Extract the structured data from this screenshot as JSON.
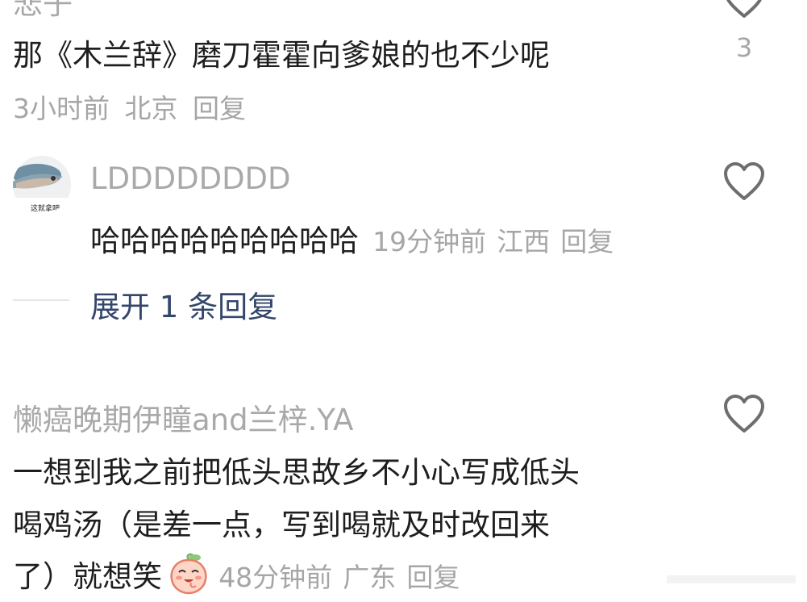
{
  "comment1": {
    "username": "悲子",
    "text": "那《木兰辞》磨刀霍霍向爹娘的也不少呢",
    "time": "3小时前",
    "location": "北京",
    "reply": "回复",
    "likes": "3"
  },
  "comment2": {
    "username": "LDDDDDDDD",
    "avatar_caption": "这就拿吧",
    "text": "哈哈哈哈哈哈哈哈哈",
    "time": "19分钟前",
    "location": "江西",
    "reply": "回复",
    "expand": "展开 1 条回复"
  },
  "comment3": {
    "username": "懒癌晚期伊瞳and兰梓.YA",
    "line1": "一想到我之前把低头思故乡不小心写成低头",
    "line2": "喝鸡汤（是差一点，写到喝就及时改回来",
    "line3": "了）就想笑",
    "time": "48分钟前",
    "location": "广东",
    "reply": "回复"
  },
  "icons": {
    "heart": "heart-outline-icon",
    "emoji": "peach-laugh-emoji"
  },
  "colors": {
    "text": "#1e1e1e",
    "muted": "#a6a6a6",
    "link": "#33466b",
    "background": "#ffffff"
  }
}
